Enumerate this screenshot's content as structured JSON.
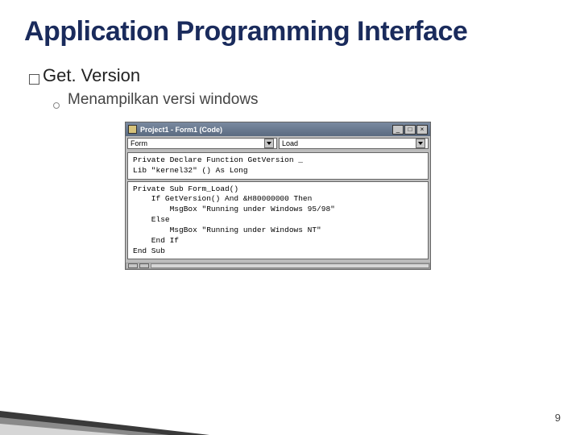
{
  "title": "Application Programming Interface",
  "bullet1_label": "Get. Version",
  "bullet2_label": "Menampilkan versi windows",
  "ide": {
    "title": "Project1 - Form1 (Code)",
    "btn_min": "_",
    "btn_max": "□",
    "btn_close": "×",
    "combo_left": "Form",
    "combo_right": "Load"
  },
  "code": {
    "block1": "Private Declare Function GetVersion _\nLib \"kernel32\" () As Long",
    "block2": "Private Sub Form_Load()\n    If GetVersion() And &H80000000 Then\n        MsgBox \"Running under Windows 95/98\"\n    Else\n        MsgBox \"Running under Windows NT\"\n    End If\nEnd Sub"
  },
  "page_number": "9"
}
